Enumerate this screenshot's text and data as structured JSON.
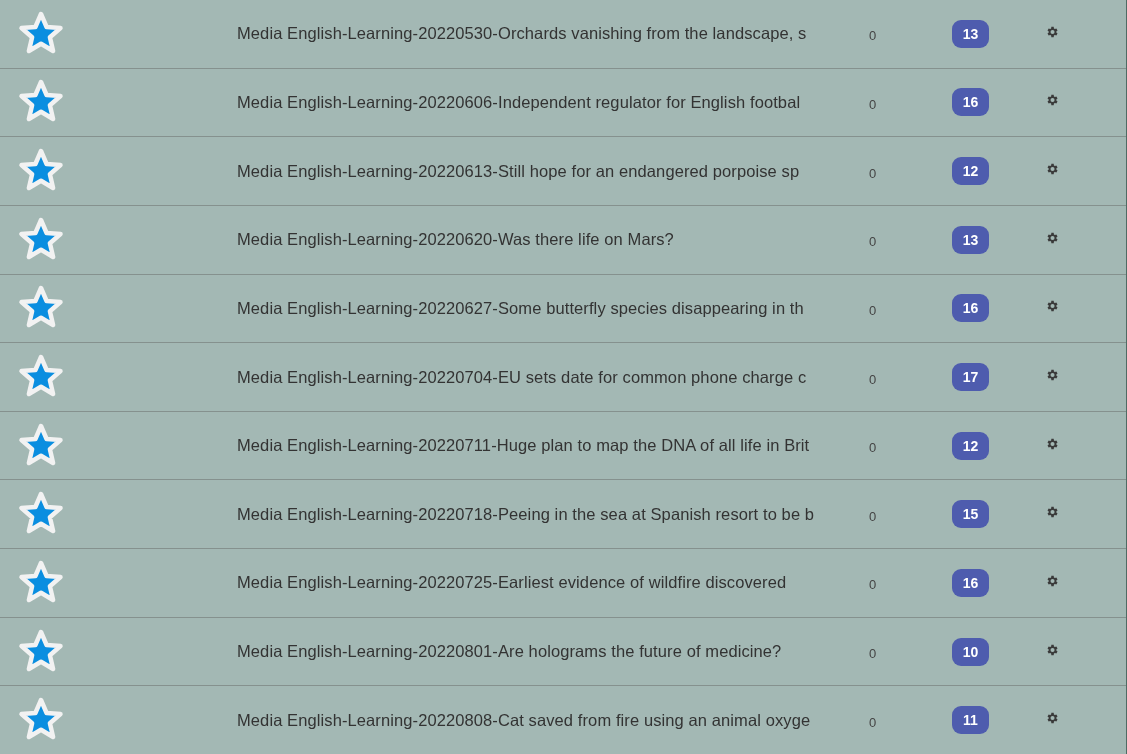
{
  "decks": [
    {
      "title": "Media English-Learning-20220530-Orchards vanishing from the landscape, s",
      "new_count": "0",
      "due_count": "13"
    },
    {
      "title": "Media English-Learning-20220606-Independent regulator for English footbal",
      "new_count": "0",
      "due_count": "16"
    },
    {
      "title": "Media English-Learning-20220613-Still hope for an endangered porpoise sp",
      "new_count": "0",
      "due_count": "12"
    },
    {
      "title": "Media English-Learning-20220620-Was there life on Mars?",
      "new_count": "0",
      "due_count": "13"
    },
    {
      "title": "Media English-Learning-20220627-Some butterfly species disappearing in th",
      "new_count": "0",
      "due_count": "16"
    },
    {
      "title": "Media English-Learning-20220704-EU sets date for common phone charge c",
      "new_count": "0",
      "due_count": "17"
    },
    {
      "title": "Media English-Learning-20220711-Huge plan to map the DNA of all life in Brit",
      "new_count": "0",
      "due_count": "12"
    },
    {
      "title": "Media English-Learning-20220718-Peeing in the sea at Spanish resort to be b",
      "new_count": "0",
      "due_count": "15"
    },
    {
      "title": "Media English-Learning-20220725-Earliest evidence of wildfire discovered",
      "new_count": "0",
      "due_count": "16"
    },
    {
      "title": "Media English-Learning-20220801-Are holograms the future of medicine?",
      "new_count": "0",
      "due_count": "10"
    },
    {
      "title": "Media English-Learning-20220808-Cat saved from fire using an animal oxyge",
      "new_count": "0",
      "due_count": "11"
    }
  ]
}
